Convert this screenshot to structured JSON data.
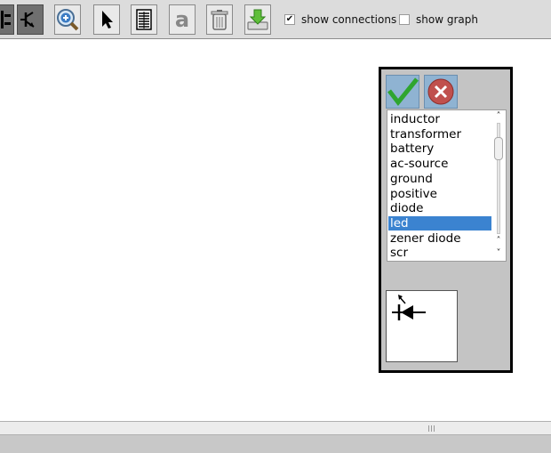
{
  "toolbar": {
    "tools": [
      {
        "name": "component-tool",
        "icon": "component-icon",
        "active": true
      },
      {
        "name": "transistor-tool",
        "icon": "transistor-icon",
        "active": true
      },
      {
        "name": "zoom-tool",
        "icon": "magnifier-plus-icon",
        "active": false
      },
      {
        "name": "select-tool",
        "icon": "arrow-pointer-icon",
        "active": false
      },
      {
        "name": "wire-tool",
        "icon": "bus-lines-icon",
        "active": false
      },
      {
        "name": "text-tool",
        "icon": "letter-a-icon",
        "active": false
      },
      {
        "name": "delete-tool",
        "icon": "trash-can-icon",
        "active": false
      },
      {
        "name": "export-tool",
        "icon": "download-tray-icon",
        "active": false
      }
    ],
    "show_connections": {
      "label": "show connections",
      "checked": true
    },
    "show_graph": {
      "label": "show graph",
      "checked": false
    }
  },
  "component_panel": {
    "ok_icon": "green-check-icon",
    "cancel_icon": "red-x-icon",
    "items": [
      "inductor",
      "transformer",
      "battery",
      "ac-source",
      "ground",
      "positive",
      "diode",
      "led",
      "zener diode",
      "scr"
    ],
    "selected": "led",
    "preview_icon": "led-symbol-icon"
  },
  "colors": {
    "selection": "#3b83d0",
    "ok_green": "#2fa52f",
    "cancel_red": "#c0504d",
    "toolbar_bg": "#dcdcdc",
    "panel_bg": "#c4c4c4"
  }
}
